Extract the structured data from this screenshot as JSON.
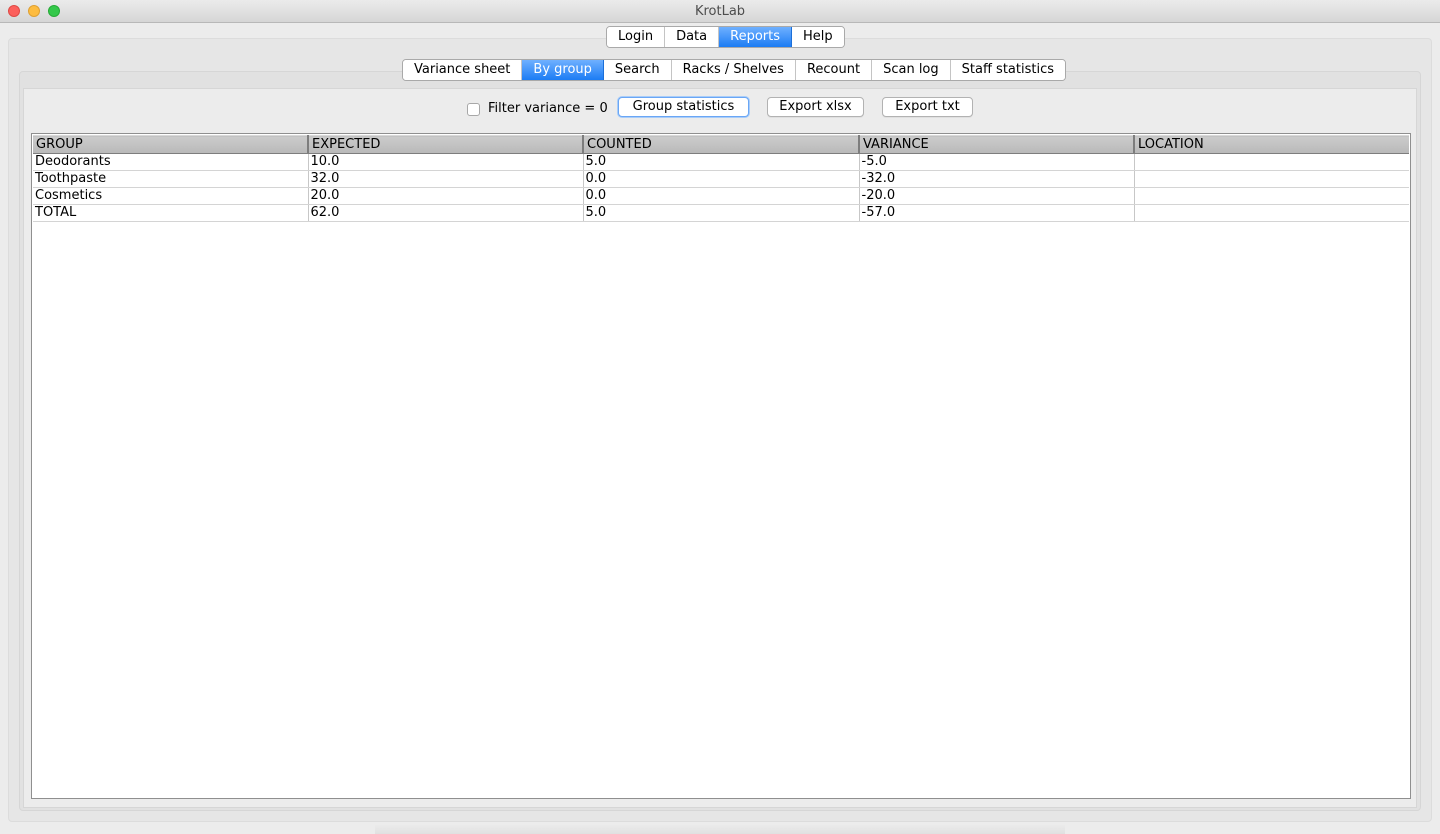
{
  "window": {
    "title": "KrotLab"
  },
  "main_tabs": [
    {
      "label": "Login",
      "active": false
    },
    {
      "label": "Data",
      "active": false
    },
    {
      "label": "Reports",
      "active": true
    },
    {
      "label": "Help",
      "active": false
    }
  ],
  "sub_tabs": [
    {
      "label": "Variance sheet",
      "active": false
    },
    {
      "label": "By group",
      "active": true
    },
    {
      "label": "Search",
      "active": false
    },
    {
      "label": "Racks / Shelves",
      "active": false
    },
    {
      "label": "Recount",
      "active": false
    },
    {
      "label": "Scan log",
      "active": false
    },
    {
      "label": "Staff statistics",
      "active": false
    }
  ],
  "toolbar": {
    "filter_label": "Filter variance = 0",
    "filter_checked": false,
    "group_statistics": "Group statistics",
    "export_xlsx": "Export xlsx",
    "export_txt": "Export txt"
  },
  "table": {
    "columns": [
      "GROUP",
      "EXPECTED",
      "COUNTED",
      "VARIANCE",
      "LOCATION"
    ],
    "rows": [
      [
        "Deodorants",
        "10.0",
        "5.0",
        "-5.0",
        ""
      ],
      [
        "Toothpaste",
        "32.0",
        "0.0",
        "-32.0",
        ""
      ],
      [
        "Cosmetics",
        "20.0",
        "0.0",
        "-20.0",
        ""
      ],
      [
        "TOTAL",
        "62.0",
        "5.0",
        "-57.0",
        ""
      ]
    ]
  },
  "colors": {
    "accent": "#1c7cf4",
    "close": "#fc605c",
    "minimize": "#fdbc40",
    "maximize": "#34c84a"
  }
}
